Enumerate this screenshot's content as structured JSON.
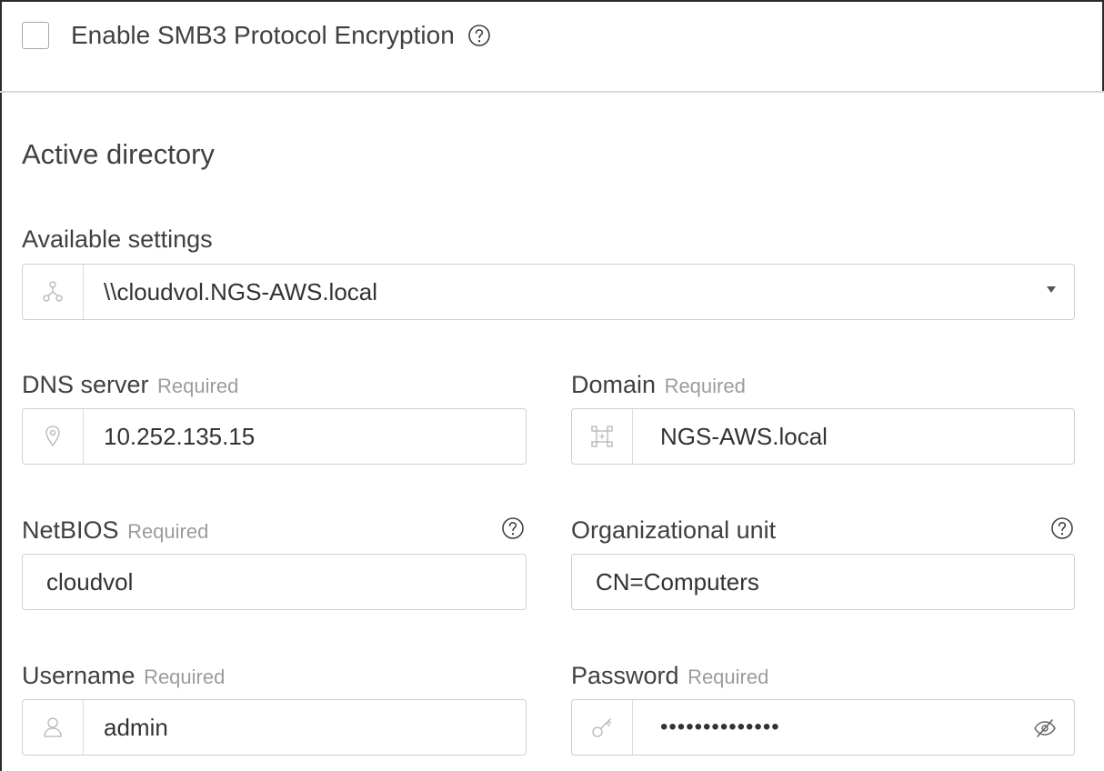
{
  "smb3": {
    "label": "Enable SMB3 Protocol Encryption",
    "checked": false,
    "help_icon": "question-circle-icon"
  },
  "active_directory": {
    "title": "Active directory",
    "available_settings": {
      "label": "Available settings",
      "value": "\\\\cloudvol.NGS-AWS.local",
      "icon": "network-icon",
      "dropdown_icon": "caret-down-icon"
    },
    "required_text": "Required",
    "dns_server": {
      "label": "DNS server",
      "value": "10.252.135.15",
      "icon": "location-pin-icon"
    },
    "domain": {
      "label": "Domain",
      "value": "NGS-AWS.local",
      "icon": "domain-icon"
    },
    "netbios": {
      "label": "NetBIOS",
      "value": "cloudvol",
      "help_icon": "question-circle-icon"
    },
    "organizational_unit": {
      "label": "Organizational unit",
      "value": "CN=Computers",
      "help_icon": "question-circle-icon"
    },
    "username": {
      "label": "Username",
      "value": "admin",
      "icon": "user-icon"
    },
    "password": {
      "label": "Password",
      "masked_value": "••••••••••••••",
      "icon": "key-icon",
      "toggle_icon": "eye-slash-icon"
    }
  },
  "colors": {
    "text": "#404040",
    "required": "#9c9c9c",
    "border": "#cfcfcf",
    "divider": "#d9d9d9",
    "icon": "#b0b0b0",
    "frame": "#2b2b2b"
  }
}
